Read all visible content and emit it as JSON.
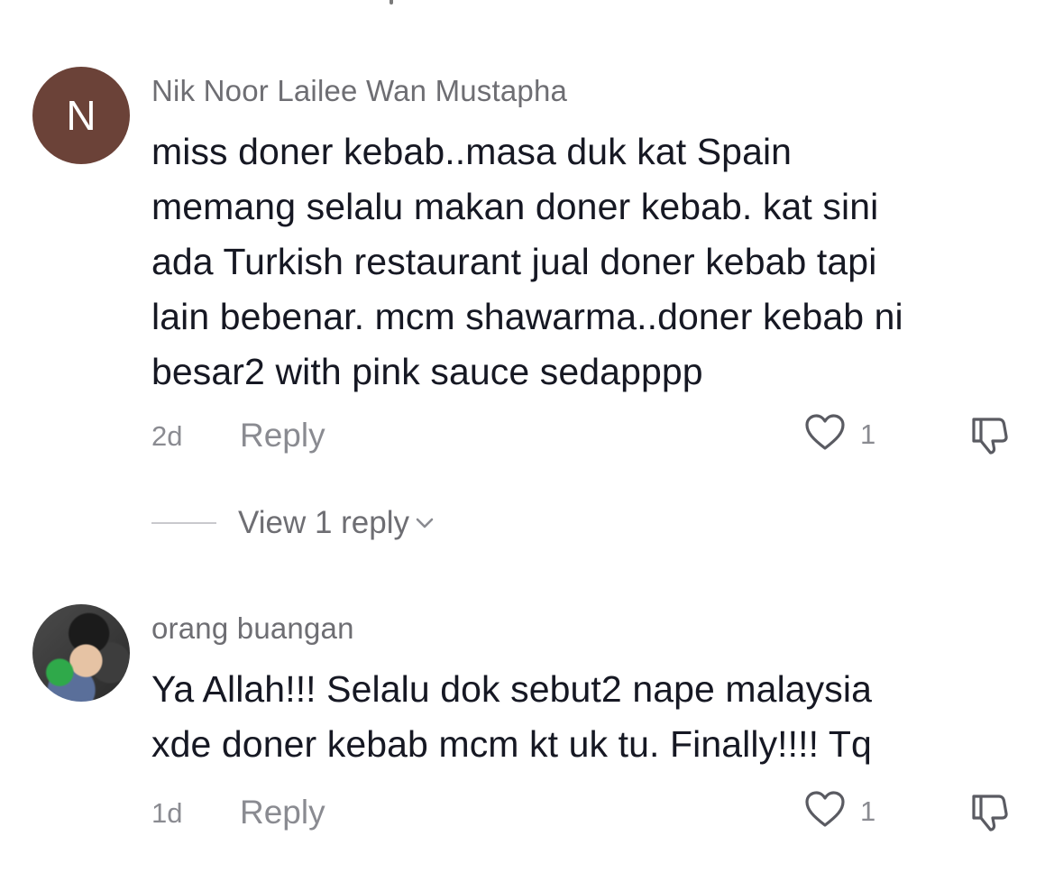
{
  "comments": [
    {
      "avatar_letter": "N",
      "username": "Nik Noor Lailee Wan Mustapha",
      "text_lines": [
        "miss doner kebab..masa duk kat Spain",
        "memang selalu makan doner kebab. kat sini",
        "ada Turkish restaurant jual doner kebab tapi",
        "lain bebenar. mcm shawarma..doner kebab ni",
        "besar2 with pink sauce sedapppp"
      ],
      "time": "2d",
      "reply_label": "Reply",
      "likes": "1",
      "view_replies_label": "View 1 reply"
    },
    {
      "username": "orang buangan",
      "text_lines": [
        "Ya Allah!!! Selalu dok sebut2 nape malaysia",
        "xde doner kebab mcm kt uk tu. Finally!!!! Tq"
      ],
      "time": "1d",
      "reply_label": "Reply",
      "likes": "1"
    }
  ],
  "icons": {
    "like": "heart-outline-icon",
    "dislike": "thumbs-down-outline-icon",
    "expand": "chevron-down-icon"
  },
  "colors": {
    "text": "#161823",
    "secondary": "#8a8b91",
    "avatar_bg": "#6b4238"
  }
}
